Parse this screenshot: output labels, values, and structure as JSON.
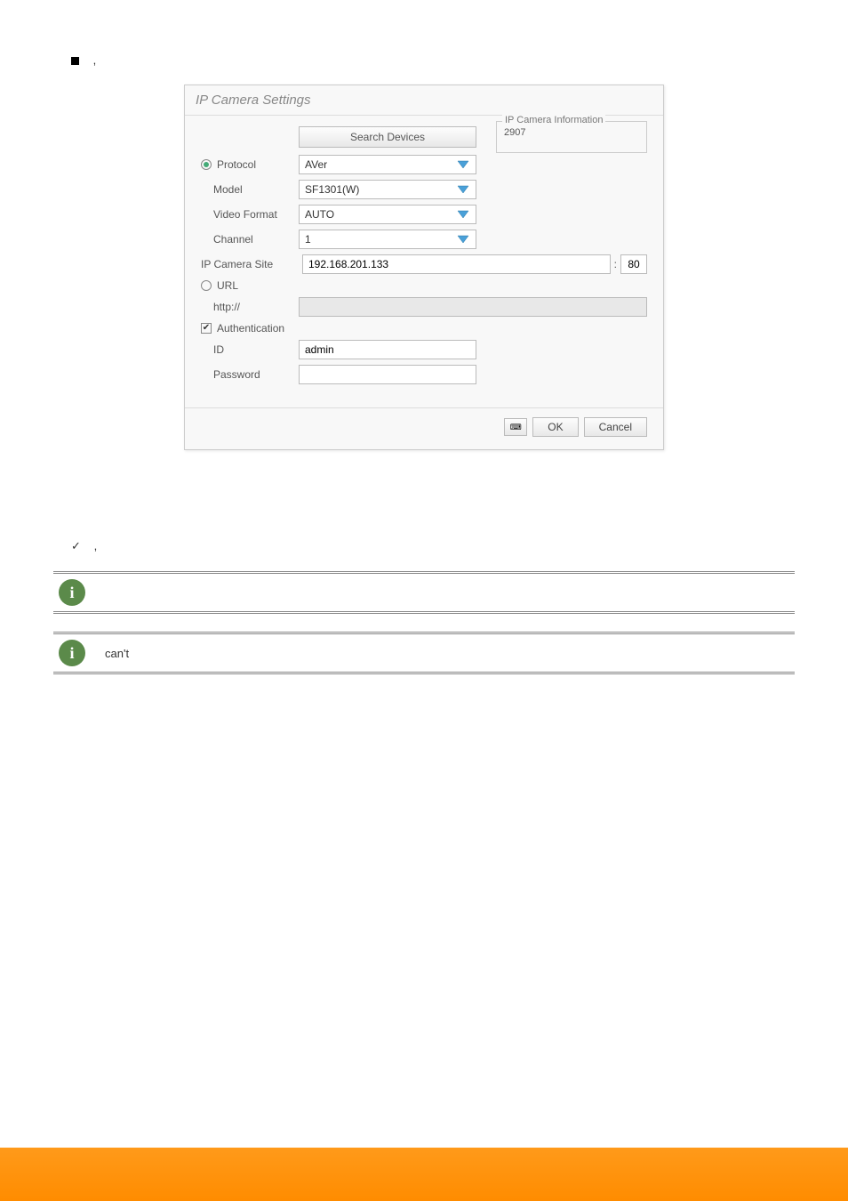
{
  "bullet_text": ",",
  "dialog": {
    "title": "IP Camera Settings",
    "search_btn": "Search Devices",
    "labels": {
      "protocol": "Protocol",
      "model": "Model",
      "video_format": "Video Format",
      "channel": "Channel",
      "ip_camera_site": "IP Camera Site",
      "url": "URL",
      "http": "http://",
      "auth": "Authentication",
      "id": "ID",
      "password": "Password"
    },
    "values": {
      "protocol": "AVer",
      "model": "SF1301(W)",
      "video_format": "AUTO",
      "channel": "1",
      "ip_camera_site": "192.168.201.133",
      "port_sep": ":",
      "port": "80",
      "id": "admin",
      "password": ""
    },
    "ip_info": {
      "legend": "IP Camera Information",
      "value": "2907"
    },
    "footer": {
      "kb": "⌨",
      "ok": "OK",
      "cancel": "Cancel"
    }
  },
  "check_text": ",",
  "link_text": "",
  "info1": "",
  "info2_pre": "",
  "info2_cant": "can't",
  "info2_post": ""
}
